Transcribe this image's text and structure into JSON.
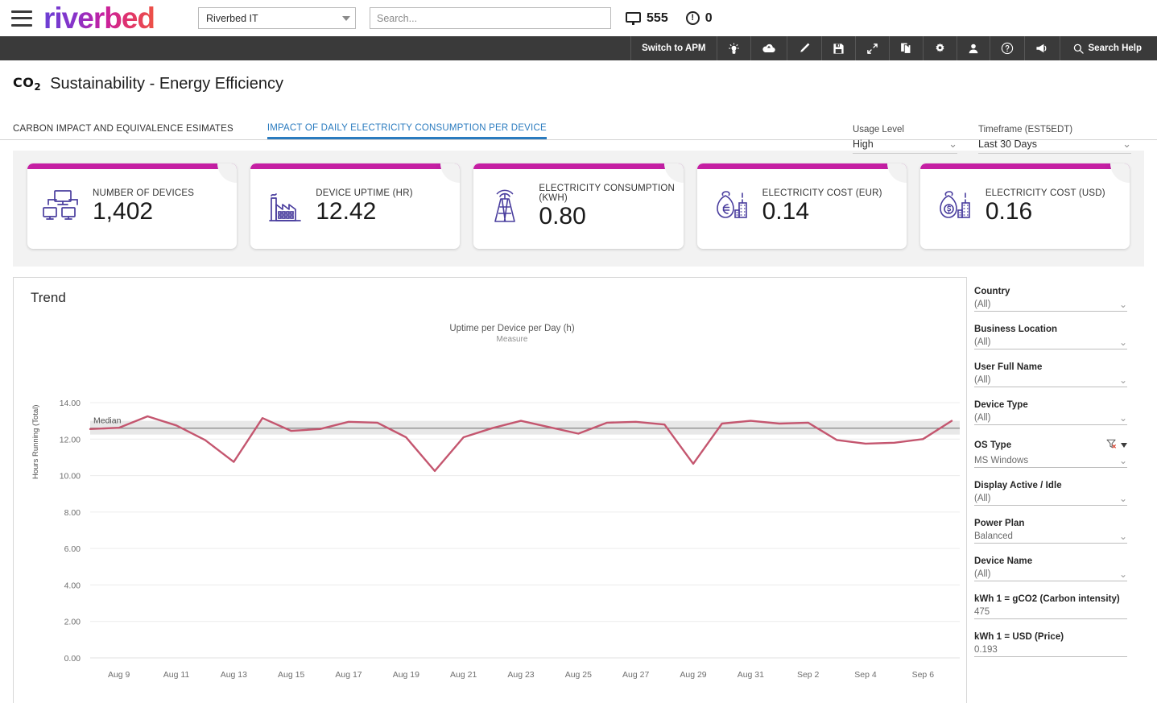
{
  "brand": {
    "logo_text": "riverbed",
    "menu_icon": "hamburger-icon"
  },
  "topbar": {
    "tenant": "Riverbed IT",
    "search_placeholder": "Search...",
    "devices_count": "555",
    "alerts_count": "0"
  },
  "toolbar": {
    "switch_label": "Switch to APM",
    "search_help_label": "Search Help",
    "items": [
      {
        "name": "lightbulb-icon"
      },
      {
        "name": "cloud-upload-icon"
      },
      {
        "name": "pencil-icon"
      },
      {
        "name": "save-icon"
      },
      {
        "name": "fullscreen-icon"
      },
      {
        "name": "copy-pages-icon"
      },
      {
        "name": "gear-icon"
      },
      {
        "name": "user-icon"
      },
      {
        "name": "help-icon"
      },
      {
        "name": "megaphone-icon"
      }
    ]
  },
  "page": {
    "co2_prefix": "CO",
    "co2_sub": "2",
    "title": "Sustainability - Energy Efficiency",
    "usage_level_label": "Usage Level",
    "usage_level_value": "High",
    "timeframe_label": "Timeframe (EST5EDT)",
    "timeframe_value": "Last 30 Days"
  },
  "tabs": [
    {
      "label": "CARBON IMPACT AND EQUIVALENCE ESIMATES",
      "active": false
    },
    {
      "label": "IMPACT OF DAILY ELECTRICITY CONSUMPTION PER DEVICE",
      "active": true
    }
  ],
  "kpis": [
    {
      "icon": "devices-network-icon",
      "label": "NUMBER OF DEVICES",
      "value": "1,402"
    },
    {
      "icon": "factory-icon",
      "label": "DEVICE UPTIME (HR)",
      "value": "12.42"
    },
    {
      "icon": "transmission-tower-icon",
      "label": "ELECTRICITY CONSUMPTION (KWH)",
      "value": "0.80"
    },
    {
      "icon": "money-bag-euro-icon",
      "label": "ELECTRICITY COST (EUR)",
      "value": "0.14"
    },
    {
      "icon": "money-bag-dollar-icon",
      "label": "ELECTRICITY COST (USD)",
      "value": "0.16"
    }
  ],
  "chart_panel": {
    "title": "Trend",
    "legend_title": "Uptime per Device per Day (h)",
    "legend_sub": "Measure",
    "median_label": "Median"
  },
  "chart_data": {
    "type": "line",
    "title": "Trend",
    "series_name": "Uptime per Device per Day (h)",
    "xlabel": "",
    "ylabel": "Hours Running (Total)",
    "ylim": [
      0,
      14
    ],
    "yticks": [
      "0.00",
      "2.00",
      "4.00",
      "6.00",
      "8.00",
      "10.00",
      "12.00",
      "14.00"
    ],
    "xticks": [
      "Aug 9",
      "Aug 11",
      "Aug 13",
      "Aug 15",
      "Aug 17",
      "Aug 19",
      "Aug 21",
      "Aug 23",
      "Aug 25",
      "Aug 27",
      "Aug 29",
      "Aug 31",
      "Sep 2",
      "Sep 4",
      "Sep 6"
    ],
    "grid": true,
    "legend_position": "top-center",
    "line_color": "#c4566f",
    "median_value": 12.6,
    "median_band": [
      12.25,
      13.0
    ],
    "x": [
      "Aug 8",
      "Aug 9",
      "Aug 10",
      "Aug 11",
      "Aug 12",
      "Aug 13",
      "Aug 14",
      "Aug 15",
      "Aug 16",
      "Aug 17",
      "Aug 18",
      "Aug 19",
      "Aug 20",
      "Aug 21",
      "Aug 22",
      "Aug 23",
      "Aug 24",
      "Aug 25",
      "Aug 26",
      "Aug 27",
      "Aug 28",
      "Aug 29",
      "Aug 30",
      "Aug 31",
      "Sep 1",
      "Sep 2",
      "Sep 3",
      "Sep 4",
      "Sep 5",
      "Sep 6",
      "Sep 7"
    ],
    "values": [
      12.55,
      12.62,
      13.25,
      12.75,
      11.95,
      10.75,
      13.15,
      12.45,
      12.55,
      12.95,
      12.9,
      12.1,
      10.25,
      12.1,
      12.6,
      13.0,
      12.65,
      12.3,
      12.9,
      12.95,
      12.8,
      10.65,
      12.85,
      13.0,
      12.85,
      12.9,
      11.95,
      11.75,
      11.8,
      12.0,
      13.0
    ]
  },
  "filters": [
    {
      "label": "Country",
      "value": "(All)",
      "type": "dropdown"
    },
    {
      "label": "Business Location",
      "value": "(All)",
      "type": "dropdown"
    },
    {
      "label": "User Full Name",
      "value": "(All)",
      "type": "dropdown"
    },
    {
      "label": "Device Type",
      "value": "(All)",
      "type": "dropdown"
    },
    {
      "label": "OS Type",
      "value": "MS Windows",
      "type": "dropdown",
      "has_clear": true
    },
    {
      "label": "Display Active / Idle",
      "value": "(All)",
      "type": "dropdown"
    },
    {
      "label": "Power Plan",
      "value": "Balanced",
      "type": "dropdown"
    },
    {
      "label": "Device Name",
      "value": "(All)",
      "type": "dropdown"
    },
    {
      "label": "kWh 1 = gCO2  (Carbon intensity)",
      "value": "475",
      "type": "text"
    },
    {
      "label": "kWh 1 = USD (Price)",
      "value": "0.193",
      "type": "text"
    }
  ],
  "colors": {
    "brand_magenta": "#c51fa3",
    "toolbar_dark": "#3a3a3a",
    "tab_active": "#2a7bbf",
    "line": "#c4566f",
    "kpi_icon": "#4a3e9e"
  }
}
